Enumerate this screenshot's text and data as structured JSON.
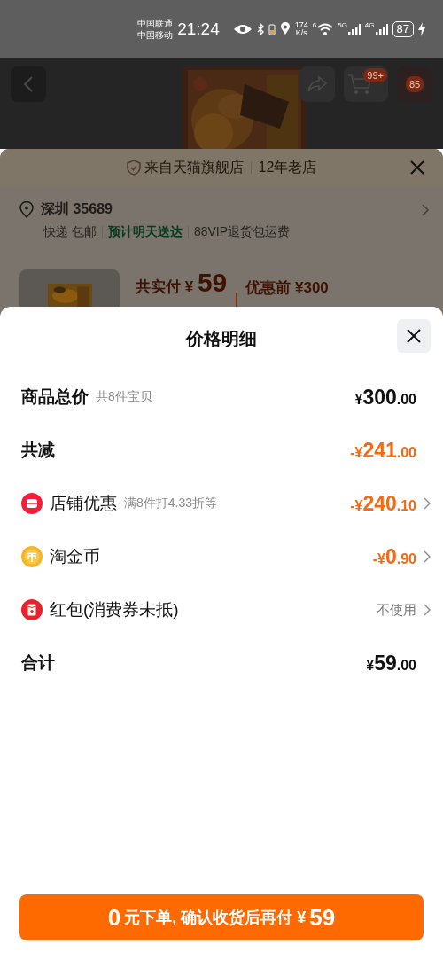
{
  "status_bar": {
    "carriers": [
      "中国联通",
      "中国移动"
    ],
    "time": "21:24",
    "speed": [
      "174",
      "K/s"
    ],
    "wifi_label": "6",
    "signals": [
      "5G",
      "4G"
    ],
    "battery": "87"
  },
  "header": {
    "badges": [
      "99+",
      "85"
    ]
  },
  "order_sheet": {
    "store": {
      "name": "来自天猫旗舰店",
      "tag": "12年老店"
    },
    "address": {
      "city": "深圳 35689",
      "delivery": "快递 包邮",
      "eta": "预计明天送达",
      "service": "88VIP退货包运费"
    },
    "price": {
      "label": "共实付",
      "currency": "¥",
      "value": "59",
      "original": "优惠前 ¥300"
    }
  },
  "price_detail": {
    "title": "价格明细",
    "rows": [
      {
        "kind": "plain",
        "label": "商品总价",
        "note": "共8件宝贝",
        "amount": {
          "prefix": "¥",
          "main": "300",
          "decimal": ".00"
        },
        "discount": false,
        "chevron": false
      },
      {
        "kind": "plain",
        "label": "共减",
        "amount": {
          "prefix": "-¥",
          "main": "241",
          "decimal": ".00"
        },
        "discount": true,
        "chevron": false
      },
      {
        "kind": "shop",
        "label": "店铺优惠",
        "note": "满8件打4.33折等",
        "amount": {
          "prefix": "-¥",
          "main": "240",
          "decimal": ".10"
        },
        "discount": true,
        "chevron": true
      },
      {
        "kind": "coin",
        "label": "淘金币",
        "amount": {
          "prefix": "-¥",
          "main": "0",
          "decimal": ".90"
        },
        "discount": true,
        "chevron": true
      },
      {
        "kind": "red_packet",
        "label": "红包(消费券未抵)",
        "value": "不使用",
        "discount": false,
        "chevron": true
      },
      {
        "kind": "plain",
        "label": "合计",
        "amount": {
          "prefix": "¥",
          "main": "59",
          "decimal": ".00"
        },
        "discount": false,
        "chevron": false
      }
    ]
  },
  "submit_button": {
    "parts": [
      {
        "text": "0",
        "big": true
      },
      {
        "text": "元下单, 确认收货后再付 ¥",
        "big": false
      },
      {
        "text": "59",
        "big": true
      }
    ]
  }
}
